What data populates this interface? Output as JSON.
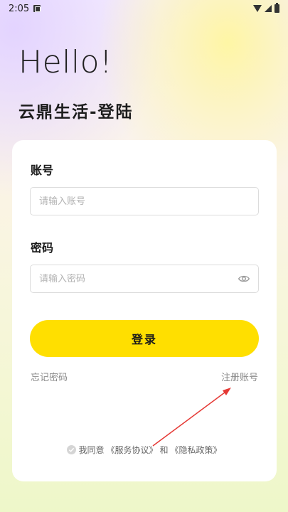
{
  "status_bar": {
    "time": "2:05"
  },
  "header": {
    "greeting": "Hello!",
    "subtitle": "云鼎生活-登陆"
  },
  "form": {
    "account_label": "账号",
    "account_placeholder": "请输入账号",
    "password_label": "密码",
    "password_placeholder": "请输入密码",
    "login_button": "登录",
    "forgot_link": "忘记密码",
    "register_link": "注册账号"
  },
  "agreement": {
    "prefix": "我同意",
    "service": "《服务协议》",
    "conj": "和",
    "privacy": "《隐私政策》"
  },
  "colors": {
    "accent": "#ffdf00",
    "arrow": "#e53935"
  }
}
